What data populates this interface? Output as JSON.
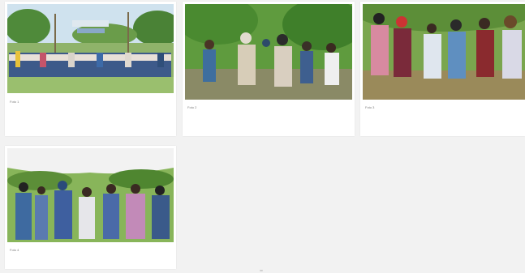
{
  "gallery": {
    "items": [
      {
        "title": "Foto 1",
        "caption": ""
      },
      {
        "title": "Foto 2",
        "caption": ""
      },
      {
        "title": "Foto 3",
        "caption": ""
      },
      {
        "title": "Foto 4",
        "caption": ""
      }
    ],
    "sign_text": ""
  },
  "colors": {
    "page_bg": "#f2f2f2",
    "card_bg": "#ffffff",
    "caption_title": "#7a7a7a",
    "caption_text": "#9a9a9a"
  }
}
